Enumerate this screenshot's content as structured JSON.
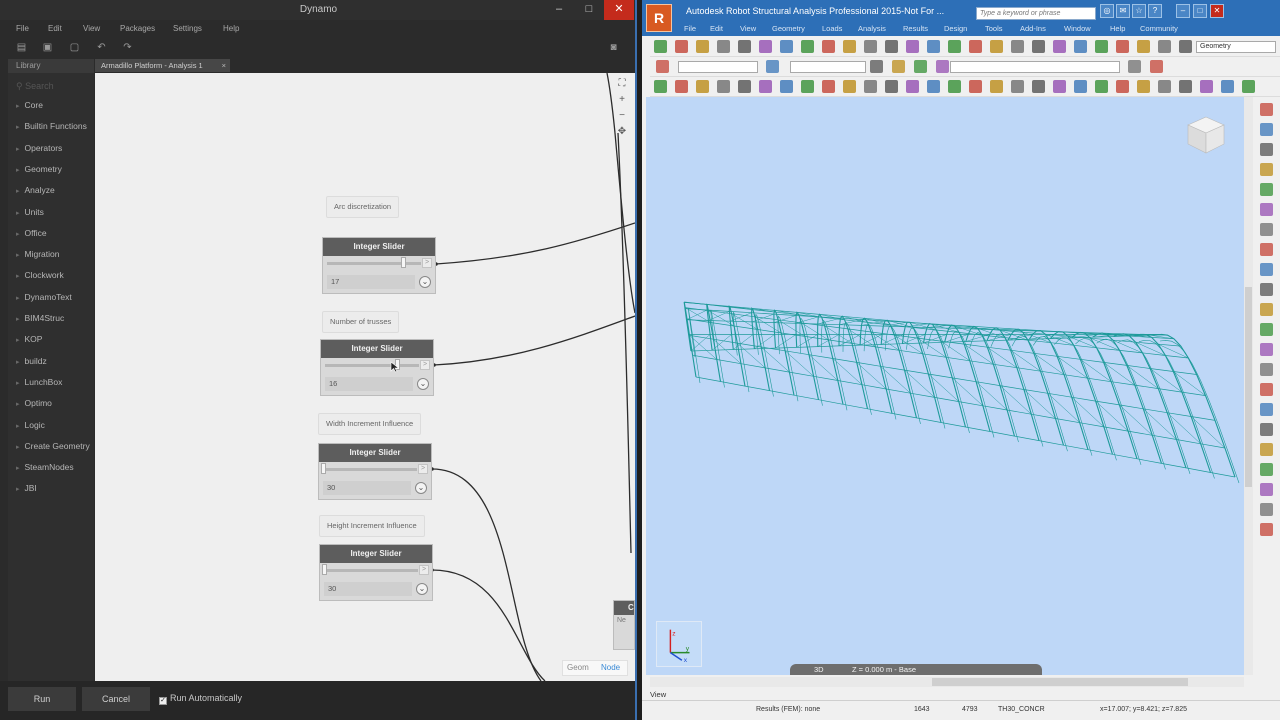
{
  "dynamo": {
    "title": "Dynamo",
    "window_controls": {
      "minimize": "–",
      "maximize": "□",
      "close": "✕"
    },
    "menu": [
      "File",
      "Edit",
      "View",
      "Packages",
      "Settings",
      "Help"
    ],
    "library_header": "Library",
    "search_placeholder": "Search",
    "library_items": [
      "Core",
      "Builtin Functions",
      "Operators",
      "Geometry",
      "Analyze",
      "Units",
      "Office",
      "Migration",
      "Clockwork",
      "DynamoText",
      "BIM4Struc",
      "KOP",
      "buildz",
      "LunchBox",
      "Optimo",
      "Logic",
      "Create Geometry",
      "SteamNodes",
      "JBI"
    ],
    "tab_label": "Armadillo Platform - Analysis 1",
    "notes": [
      "Arc discretization",
      "Number of trusses",
      "Width Increment Influence",
      "Height Increment Influence"
    ],
    "nodes": [
      {
        "title": "Integer Slider",
        "value": "17",
        "out": ">",
        "toggle": "⌄",
        "level": 0.84
      },
      {
        "title": "Integer Slider",
        "value": "16",
        "out": ">",
        "toggle": "⌄",
        "level": 0.8
      },
      {
        "title": "Integer Slider",
        "value": "30",
        "out": ">",
        "toggle": "⌄",
        "level": 0.0
      },
      {
        "title": "Integer Slider",
        "value": "30",
        "out": ">",
        "toggle": "⌄",
        "level": 0.0
      }
    ],
    "partial_node_title": "C",
    "partial_node_sub": "Ne",
    "view_toggle": {
      "geom": "Geom",
      "node": "Node"
    },
    "buttons": {
      "run": "Run",
      "cancel": "Cancel"
    },
    "run_automatically": {
      "label": "Run Automatically",
      "checked": "✓"
    }
  },
  "robot": {
    "title": "Autodesk Robot Structural Analysis Professional 2015-Not For ...",
    "logo": "R",
    "search_placeholder": "Type a keyword or phrase",
    "menu": [
      "File",
      "Edit",
      "View",
      "Geometry",
      "Loads",
      "Analysis",
      "Results",
      "Design",
      "Tools",
      "Add-Ins",
      "Window",
      "Help",
      "Community"
    ],
    "geometry_combo": "Geometry",
    "tabs": [
      "3D",
      "Z = 0.000 m - Base"
    ],
    "view_label": "View",
    "status": {
      "results": "Results (FEM): none",
      "nodes": "1643",
      "bars": "4793",
      "section": "TH30_CONCR",
      "coords": "x=17.007; y=8.421; z=7.825"
    },
    "colors": {
      "model": "#1e9a9a",
      "viewport": "#bed7f7",
      "titlebar": "#2d6fb7"
    }
  }
}
